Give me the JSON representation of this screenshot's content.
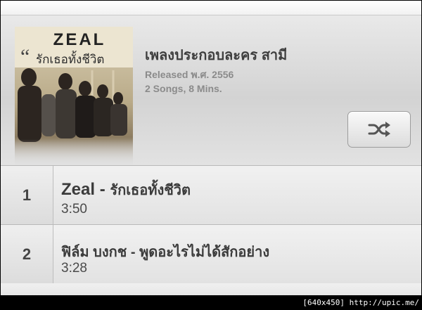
{
  "album": {
    "title": "เพลงประกอบละคร สามี",
    "released": "Released พ.ศ. 2556",
    "info": "2 Songs, 8 Mins.",
    "art_text": "รักเธอทั้งชีวิต",
    "art_brand": "ZEAL"
  },
  "shuffle": {
    "icon": "shuffle-icon"
  },
  "tracks": [
    {
      "number": "1",
      "artist": "Zeal",
      "sep": " - ",
      "song": "รักเธอทั้งชีวิต",
      "duration": "3:50"
    },
    {
      "number": "2",
      "label": "ฟิล์ม บงกช - พูดอะไรไม่ได้สักอย่าง",
      "duration": "3:28"
    }
  ],
  "watermark": "[640x450] http://upic.me/"
}
